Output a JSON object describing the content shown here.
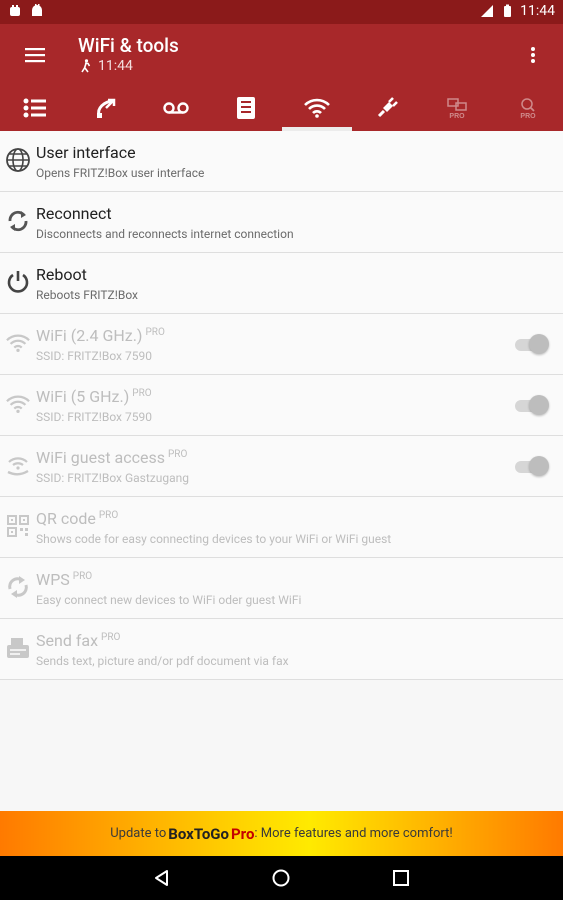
{
  "status_bar": {
    "time": "11:44"
  },
  "app_bar": {
    "title": "WiFi & tools",
    "subtitle_time": "11:44",
    "tabs": [
      {
        "icon": "list-icon",
        "active": false,
        "pro": false
      },
      {
        "icon": "call-icon",
        "active": false,
        "pro": false
      },
      {
        "icon": "voicemail-icon",
        "active": false,
        "pro": false
      },
      {
        "icon": "phonebook-icon",
        "active": false,
        "pro": false
      },
      {
        "icon": "wifi-icon",
        "active": true,
        "pro": false
      },
      {
        "icon": "plug-icon",
        "active": false,
        "pro": false
      },
      {
        "icon": "network-pro-icon",
        "active": false,
        "pro": true,
        "badge": "PRO"
      },
      {
        "icon": "search-pro-icon",
        "active": false,
        "pro": true,
        "badge": "PRO"
      }
    ]
  },
  "items": [
    {
      "title": "User interface",
      "pro": "",
      "subtitle": "Opens FRITZ!Box user interface",
      "icon": "globe-icon",
      "disabled": false,
      "toggle": false
    },
    {
      "title": "Reconnect",
      "pro": "",
      "subtitle": "Disconnects and reconnects internet connection",
      "icon": "reconnect-icon",
      "disabled": false,
      "toggle": false
    },
    {
      "title": "Reboot",
      "pro": "",
      "subtitle": "Reboots FRITZ!Box",
      "icon": "power-icon",
      "disabled": false,
      "toggle": false
    },
    {
      "title": "WiFi (2.4 GHz.)",
      "pro": "PRO",
      "subtitle": "SSID: FRITZ!Box 7590",
      "icon": "wifi-icon",
      "disabled": true,
      "toggle": true
    },
    {
      "title": "WiFi (5 GHz.)",
      "pro": "PRO",
      "subtitle": "SSID: FRITZ!Box 7590",
      "icon": "wifi-icon",
      "disabled": true,
      "toggle": true
    },
    {
      "title": "WiFi guest access",
      "pro": "PRO",
      "subtitle": "SSID: FRITZ!Box Gastzugang",
      "icon": "wifi-guest-icon",
      "disabled": true,
      "toggle": true
    },
    {
      "title": "QR code",
      "pro": "PRO",
      "subtitle": "Shows code for easy connecting devices to your WiFi or WiFi guest",
      "icon": "qr-code-icon",
      "disabled": true,
      "toggle": false
    },
    {
      "title": "WPS",
      "pro": "PRO",
      "subtitle": "Easy connect new devices to WiFi oder guest WiFi",
      "icon": "wps-icon",
      "disabled": true,
      "toggle": false
    },
    {
      "title": "Send fax",
      "pro": "PRO",
      "subtitle": "Sends text, picture and/or pdf document via fax",
      "icon": "fax-icon",
      "disabled": true,
      "toggle": false
    }
  ],
  "promo": {
    "prefix": "Update to ",
    "brand": "BoxToGo",
    "pro": " Pro",
    "suffix": ": More features and more comfort!"
  },
  "colors": {
    "app_bar": "#a8282a",
    "status_bar": "#8b1a1a",
    "promo_start": "#ff7a00",
    "promo_mid": "#ffea00"
  }
}
